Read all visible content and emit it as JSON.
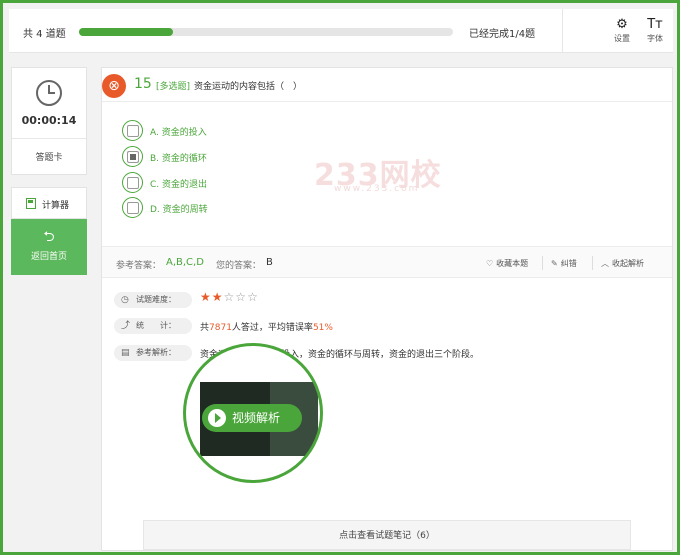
{
  "header": {
    "total_label": "共 4 道题",
    "progress_text": "已经完成1/4题",
    "progress_fraction": 0.25,
    "settings_label": "设置",
    "fontsize_label": "字体",
    "settings_icon": "gear-icon",
    "fontsize_icon": "font-size-icon",
    "fontsize_glyph": "Tт"
  },
  "sidebar": {
    "timer": "00:00:14",
    "answer_card_label": "答题卡",
    "calculator_label": "计算器",
    "home_label": "返回首页",
    "home_icon_glyph": "⮌"
  },
  "question": {
    "status_icon": "wrong-icon",
    "status_glyph": "⊗",
    "number": "15",
    "type": "[多选题]",
    "text": "资金运动的内容包括（　）",
    "options": [
      {
        "label": "A. 资金的投入",
        "checked": false
      },
      {
        "label": "B. 资金的循环",
        "checked": true
      },
      {
        "label": "C. 资金的退出",
        "checked": false
      },
      {
        "label": "D. 资金的周转",
        "checked": false
      }
    ]
  },
  "watermark": {
    "text": "233网校",
    "subtext": "www.233.com"
  },
  "answer_bar": {
    "reference_label": "参考答案：",
    "reference_value": "A,B,C,D",
    "mine_label": "您的答案：",
    "mine_value": "B",
    "favorite_label": "收藏本题",
    "correction_label": "纠错",
    "collapse_label": "收起解析",
    "favorite_glyph": "♡",
    "correction_glyph": "✎",
    "collapse_glyph": "︿"
  },
  "details": {
    "difficulty_label": "试题难度：",
    "difficulty_stars": 2,
    "difficulty_max": 5,
    "stats_label": "统　　计：",
    "stats_prefix": "共",
    "stats_count": "7871",
    "stats_middle": "人答过，平均错误率",
    "stats_rate": "51%",
    "analysis_label": "参考解析：",
    "analysis_text": "资金运动包括资金的投入，资金的循环与周转，资金的退出三个阶段。",
    "video_label": "视频解析"
  },
  "notes_button": "点击查看试题笔记（6）",
  "colors": {
    "accent": "#4aa63a",
    "wrong": "#e85a2a"
  }
}
